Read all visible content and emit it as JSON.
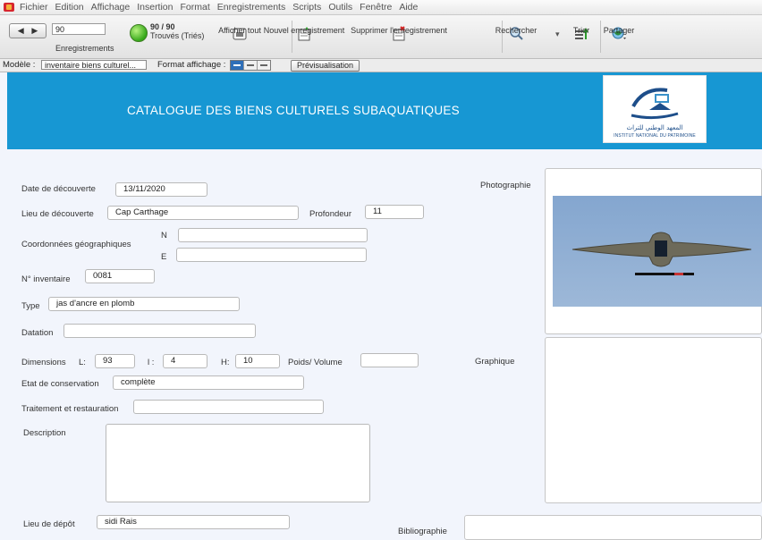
{
  "menu": [
    "Fichier",
    "Edition",
    "Affichage",
    "Insertion",
    "Format",
    "Enregistrements",
    "Scripts",
    "Outils",
    "Fenêtre",
    "Aide"
  ],
  "toolbar": {
    "record_number": "90",
    "records_label": "Enregistrements",
    "found_count": "90 / 90",
    "found_label": "Trouvés (Triés)",
    "show_all": "Afficher tout",
    "new_record": "Nouvel enregistrement",
    "delete_record": "Supprimer l'enregistrement",
    "search": "Rechercher",
    "sort": "Trier",
    "share": "Partager"
  },
  "layoutbar": {
    "model_label": "Modèle :",
    "model_value": "inventaire biens culturel...",
    "format_label": "Format affichage :",
    "preview": "Prévisualisation"
  },
  "header": {
    "title": "CATALOGUE DES BIENS CULTURELS SUBAQUATIQUES",
    "logo_arabic": "المعهد الوطني للتراث",
    "logo_caption": "INSTITUT NATIONAL DU PATRIMOINE"
  },
  "form": {
    "date_label": "Date de découverte",
    "date_value": "13/11/2020",
    "lieu_label": "Lieu de découverte",
    "lieu_value": "Cap Carthage",
    "profondeur_label": "Profondeur",
    "profondeur_value": "11",
    "coord_label": "Coordonnées géographiques",
    "n_label": "N",
    "n_value": "",
    "e_label": "E",
    "e_value": "",
    "inventaire_label": "N° inventaire",
    "inventaire_value": "0081",
    "type_label": "Type",
    "type_value": "jas d'ancre en plomb",
    "datation_label": "Datation",
    "datation_value": "",
    "dimensions_label": "Dimensions",
    "l_label": "L:",
    "l_value": "93",
    "i_label": "l :",
    "i_value": "4",
    "h_label": "H:",
    "h_value": "10",
    "poids_label": "Poids/ Volume",
    "poids_value": "",
    "etat_label": "Etat de conservation",
    "etat_value": "complète",
    "traitement_label": "Traitement et restauration",
    "traitement_value": "",
    "description_label": "Description",
    "description_value": "",
    "depot_label": "Lieu de dépôt",
    "depot_value": "sidi Rais",
    "photo_label": "Photographie",
    "graphique_label": "Graphique",
    "biblio_label": "Bibliographie"
  },
  "colors": {
    "header_band": "#1797d3",
    "form_background": "#f2f5fc"
  }
}
